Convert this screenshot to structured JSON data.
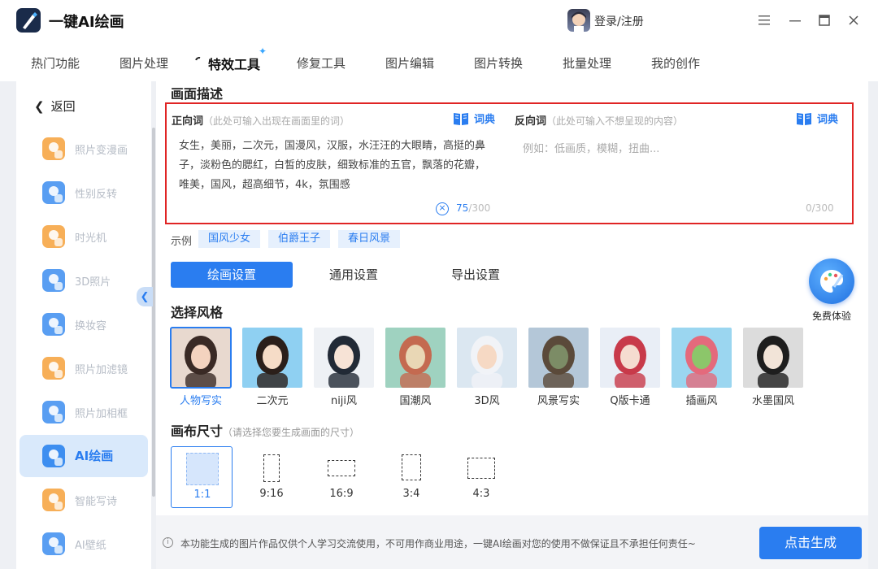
{
  "app": {
    "title": "一键AI绘画",
    "login": "登录/注册"
  },
  "window": {
    "menu_icon": "hamburger-icon",
    "minimize_icon": "minimize-icon",
    "maximize_icon": "maximize-icon",
    "close_icon": "close-icon"
  },
  "nav": {
    "tabs": [
      "热门功能",
      "图片处理",
      "特效工具",
      "修复工具",
      "图片编辑",
      "图片转换",
      "批量处理",
      "我的创作"
    ],
    "active": "特效工具"
  },
  "sidebar": {
    "back": "返回",
    "items": [
      {
        "label": "照片变漫画",
        "icon": "cartoon-icon",
        "color": "#f6a23c"
      },
      {
        "label": "性别反转",
        "icon": "gender-swap-icon",
        "color": "#3d8ef0"
      },
      {
        "label": "时光机",
        "icon": "time-machine-icon",
        "color": "#f6a23c"
      },
      {
        "label": "3D照片",
        "icon": "3d-photo-icon",
        "color": "#3d8ef0"
      },
      {
        "label": "换妆容",
        "icon": "makeup-icon",
        "color": "#3d8ef0"
      },
      {
        "label": "照片加滤镜",
        "icon": "filter-icon",
        "color": "#f6a23c"
      },
      {
        "label": "照片加相框",
        "icon": "frame-icon",
        "color": "#3d8ef0"
      },
      {
        "label": "AI绘画",
        "icon": "ai-paint-icon",
        "color": "#3d8ef0",
        "active": true
      },
      {
        "label": "智能写诗",
        "icon": "poem-icon",
        "color": "#f6a23c"
      },
      {
        "label": "AI壁纸",
        "icon": "wallpaper-icon",
        "color": "#3d8ef0"
      }
    ]
  },
  "description": {
    "title": "画面描述",
    "positive": {
      "label": "正向词",
      "hint": "（此处可输入出现在画面里的词）",
      "dict": "词典",
      "value": "女生，美丽，二次元，国漫风，汉服，水汪汪的大眼睛，高挺的鼻子，淡粉色的腮红，白皙的皮肤，细致标准的五官，飘落的花瓣，唯美，国风，超高细节，4k，氛围感",
      "count": "75",
      "max": "/300"
    },
    "negative": {
      "label": "反向词",
      "hint": "（此处可输入不想呈现的内容）",
      "dict": "词典",
      "placeholder": "例如：低画质，模糊，扭曲...",
      "count": "0/300"
    }
  },
  "examples": {
    "label": "示例",
    "chips": [
      "国风少女",
      "伯爵王子",
      "春日风景"
    ]
  },
  "settings_tabs": [
    "绘画设置",
    "通用设置",
    "导出设置"
  ],
  "style": {
    "title": "选择风格",
    "items": [
      "人物写实",
      "二次元",
      "niji风",
      "国潮风",
      "3D风",
      "风景写实",
      "Q版卡通",
      "插画风",
      "水墨国风"
    ],
    "selected": "人物写实"
  },
  "canvas": {
    "title": "画布尺寸",
    "hint": "（请选择您要生成画面的尺寸）",
    "ratios": [
      "1:1",
      "9:16",
      "16:9",
      "3:4",
      "4:3"
    ],
    "selected": "1:1"
  },
  "free_trial": "免费体验",
  "footer": {
    "disclaimer": "本功能生成的图片作品仅供个人学习交流使用，不可用作商业用途，一键AI绘画对您的使用不做保证且不承担任何责任~",
    "generate": "点击生成"
  }
}
